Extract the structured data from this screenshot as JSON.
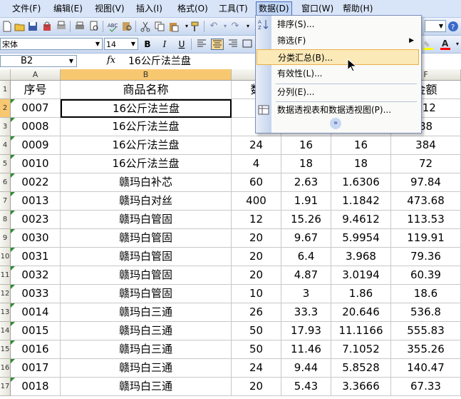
{
  "menubar": {
    "items": [
      {
        "label": "文件(F)"
      },
      {
        "label": "编辑(E)"
      },
      {
        "label": "视图(V)"
      },
      {
        "label": "插入(I)"
      },
      {
        "label": "格式(O)"
      },
      {
        "label": "工具(T)"
      },
      {
        "label": "数据(D)"
      },
      {
        "label": "窗口(W)"
      },
      {
        "label": "帮助(H)"
      }
    ],
    "active": "数据(D)"
  },
  "toolbar": {
    "font_name": "宋体",
    "font_size": "14",
    "bold_label": "B",
    "italic_label": "I",
    "underline_label": "U",
    "undo_icon": "undo-icon",
    "font_color": "#ff0000",
    "highlight_color": "#ffff00"
  },
  "formula_bar": {
    "name_box": "B2",
    "fx_label": "fx",
    "formula": "16公斤法兰盘"
  },
  "columns": {
    "a": "A",
    "b": "B",
    "f": "F"
  },
  "header_row": {
    "number": "1",
    "cells": [
      "序号",
      "商品名称",
      "数",
      "",
      "",
      "金额"
    ]
  },
  "rows": [
    {
      "num": "2",
      "id": "0007",
      "name": "16公斤法兰盘",
      "qty": "",
      "price": "",
      "cost": "",
      "amount": "112"
    },
    {
      "num": "3",
      "id": "0008",
      "name": "16公斤法兰盘",
      "qty": "",
      "price": "",
      "cost": "",
      "amount": "88"
    },
    {
      "num": "4",
      "id": "0009",
      "name": "16公斤法兰盘",
      "qty": "24",
      "price": "16",
      "cost": "16",
      "amount": "384"
    },
    {
      "num": "5",
      "id": "0010",
      "name": "16公斤法兰盘",
      "qty": "4",
      "price": "18",
      "cost": "18",
      "amount": "72"
    },
    {
      "num": "6",
      "id": "0022",
      "name": "赣玛白补芯",
      "qty": "60",
      "price": "2.63",
      "cost": "1.6306",
      "amount": "97.84"
    },
    {
      "num": "7",
      "id": "0013",
      "name": "赣玛白对丝",
      "qty": "400",
      "price": "1.91",
      "cost": "1.1842",
      "amount": "473.68"
    },
    {
      "num": "8",
      "id": "0023",
      "name": "赣玛白管固",
      "qty": "12",
      "price": "15.26",
      "cost": "9.4612",
      "amount": "113.53"
    },
    {
      "num": "9",
      "id": "0030",
      "name": "赣玛白管固",
      "qty": "20",
      "price": "9.67",
      "cost": "5.9954",
      "amount": "119.91"
    },
    {
      "num": "10",
      "id": "0031",
      "name": "赣玛白管固",
      "qty": "20",
      "price": "6.4",
      "cost": "3.968",
      "amount": "79.36"
    },
    {
      "num": "11",
      "id": "0032",
      "name": "赣玛白管固",
      "qty": "20",
      "price": "4.87",
      "cost": "3.0194",
      "amount": "60.39"
    },
    {
      "num": "12",
      "id": "0033",
      "name": "赣玛白管固",
      "qty": "10",
      "price": "3",
      "cost": "1.86",
      "amount": "18.6"
    },
    {
      "num": "13",
      "id": "0014",
      "name": "赣玛白三通",
      "qty": "26",
      "price": "33.3",
      "cost": "20.646",
      "amount": "536.8"
    },
    {
      "num": "14",
      "id": "0015",
      "name": "赣玛白三通",
      "qty": "50",
      "price": "17.93",
      "cost": "11.1166",
      "amount": "555.83"
    },
    {
      "num": "15",
      "id": "0016",
      "name": "赣玛白三通",
      "qty": "50",
      "price": "11.46",
      "cost": "7.1052",
      "amount": "355.26"
    },
    {
      "num": "16",
      "id": "0017",
      "name": "赣玛白三通",
      "qty": "24",
      "price": "9.44",
      "cost": "5.8528",
      "amount": "140.47"
    },
    {
      "num": "17",
      "id": "0018",
      "name": "赣玛白三通",
      "qty": "20",
      "price": "5.43",
      "cost": "3.3666",
      "amount": "67.33"
    }
  ],
  "data_menu": {
    "items": [
      {
        "label": "排序(S)...",
        "icon": "sort-icon"
      },
      {
        "label": "筛选(F)",
        "icon": "",
        "submenu": true
      },
      {
        "label": "分类汇总(B)...",
        "icon": "",
        "highlighted": true
      },
      {
        "label": "有效性(L)...",
        "icon": ""
      },
      {
        "label": "分列(E)...",
        "icon": ""
      },
      {
        "label": "数据透视表和数据透视图(P)...",
        "icon": "pivot-table-icon"
      }
    ],
    "more_icon": "expand-more-icon"
  }
}
